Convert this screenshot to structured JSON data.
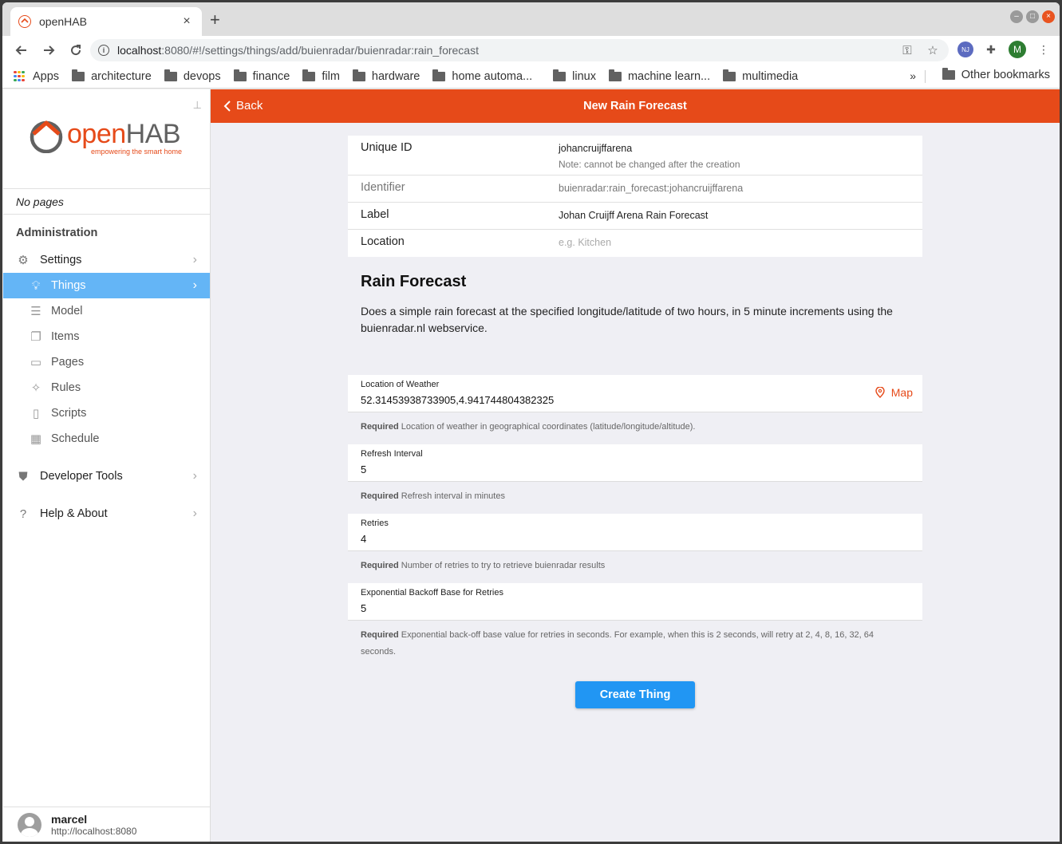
{
  "browser": {
    "tab_title": "openHAB",
    "url_host": "localhost",
    "url_rest": ":8080/#!/settings/things/add/buienradar/buienradar:rain_forecast",
    "profile_initial": "M",
    "bookmarks": [
      {
        "label": "architecture"
      },
      {
        "label": "devops"
      },
      {
        "label": "finance"
      },
      {
        "label": "film"
      },
      {
        "label": "hardware"
      },
      {
        "label": "home automa..."
      },
      {
        "label": "linux"
      },
      {
        "label": "machine learn..."
      },
      {
        "label": "multimedia"
      }
    ],
    "apps_label": "Apps",
    "more_label": "»",
    "other_bookmarks": "Other bookmarks"
  },
  "sidebar": {
    "logo_open": "open",
    "logo_hab": "HAB",
    "logo_tagline": "empowering the smart home",
    "no_pages": "No pages",
    "section_title": "Administration",
    "settings": "Settings",
    "things": "Things",
    "model": "Model",
    "items": "Items",
    "pages": "Pages",
    "rules": "Rules",
    "scripts": "Scripts",
    "schedule": "Schedule",
    "developer_tools": "Developer Tools",
    "help_about": "Help & About",
    "user_name": "marcel",
    "user_url": "http://localhost:8080"
  },
  "header": {
    "back": "Back",
    "title": "New Rain Forecast"
  },
  "thing": {
    "unique_id_label": "Unique ID",
    "unique_id_value": "johancruijffarena",
    "unique_id_note": "Note: cannot be changed after the creation",
    "identifier_label": "Identifier",
    "identifier_value": "buienradar:rain_forecast:johancruijffarena",
    "label_label": "Label",
    "label_value": "Johan Cruijff Arena Rain Forecast",
    "location_label": "Location",
    "location_placeholder": "e.g. Kitchen"
  },
  "description": {
    "title": "Rain Forecast",
    "text": "Does a simple rain forecast at the specified longitude/latitude of two hours, in 5 minute increments using the buienradar.nl webservice."
  },
  "params": {
    "required": "Required",
    "location": {
      "label": "Location of Weather",
      "value": "52.31453938733905,4.941744804382325",
      "help": "Location of weather in geographical coordinates (latitude/longitude/altitude).",
      "map": "Map"
    },
    "refresh": {
      "label": "Refresh Interval",
      "value": "5",
      "help": "Refresh interval in minutes"
    },
    "retries": {
      "label": "Retries",
      "value": "4",
      "help": "Number of retries to try to retrieve buienradar results"
    },
    "backoff": {
      "label": "Exponential Backoff Base for Retries",
      "value": "5",
      "help": "Exponential back-off base value for retries in seconds. For example, when this is 2 seconds, will retry at 2, 4, 8, 16, 32, 64 seconds."
    }
  },
  "create_button": "Create Thing",
  "colors": {
    "brand": "#e64a19",
    "active": "#64b5f6",
    "primary": "#2196f3"
  }
}
